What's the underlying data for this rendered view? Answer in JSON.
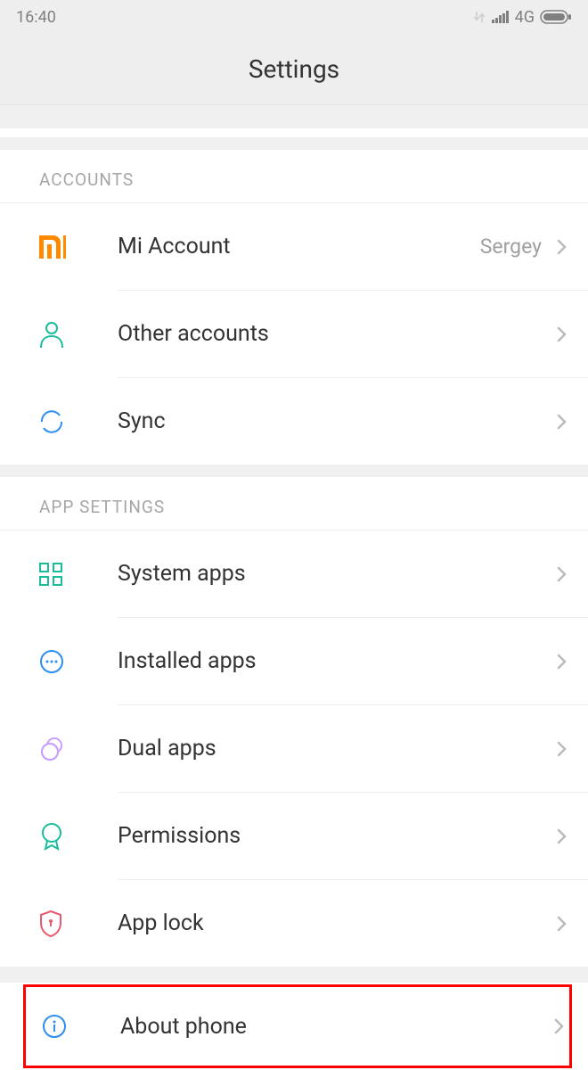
{
  "statusBar": {
    "time": "16:40",
    "network": "4G"
  },
  "header": {
    "title": "Settings"
  },
  "sections": {
    "accounts": {
      "header": "ACCOUNTS",
      "items": [
        {
          "label": "Mi Account",
          "value": "Sergey"
        },
        {
          "label": "Other accounts"
        },
        {
          "label": "Sync"
        }
      ]
    },
    "appSettings": {
      "header": "APP SETTINGS",
      "items": [
        {
          "label": "System apps"
        },
        {
          "label": "Installed apps"
        },
        {
          "label": "Dual apps"
        },
        {
          "label": "Permissions"
        },
        {
          "label": "App lock"
        }
      ]
    },
    "about": {
      "items": [
        {
          "label": "About phone"
        }
      ]
    }
  }
}
